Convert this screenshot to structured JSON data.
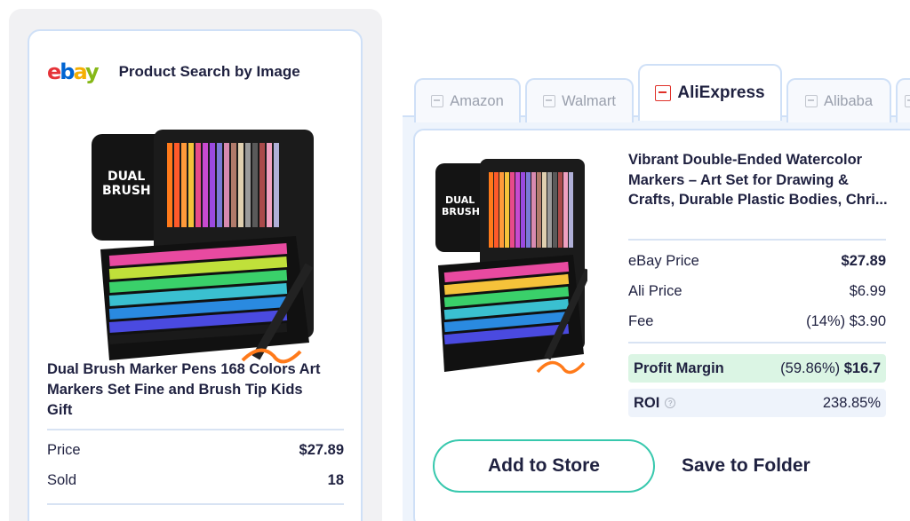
{
  "left_panel": {
    "header_title": "Product Search by Image",
    "logo": {
      "e": "e",
      "b": "b",
      "a": "a",
      "y": "y"
    },
    "product_title": "Dual Brush Marker Pens 168 Colors Art Markers Set Fine and Brush Tip Kids Gift",
    "price_label": "Price",
    "price_value": "$27.89",
    "sold_label": "Sold",
    "sold_value": "18"
  },
  "tabs": [
    {
      "label": "Amazon",
      "icon": "store-icon"
    },
    {
      "label": "Walmart",
      "icon": "store-icon"
    },
    {
      "label": "AliExpress",
      "icon": "aliexpress-bag-icon",
      "active": true
    },
    {
      "label": "Alibaba",
      "icon": "store-icon"
    }
  ],
  "right_panel": {
    "product_title": "Vibrant Double-Ended Watercolor Markers – Art Set for Drawing & Crafts, Durable Plastic Bodies, Chri...",
    "ebay_price_label": "eBay Price",
    "ebay_price_value": "$27.89",
    "ali_price_label": "Ali Price",
    "ali_price_value": "$6.99",
    "fee_label": "Fee",
    "fee_value": "(14%) $3.90",
    "profit_label": "Profit Margin",
    "profit_percent": "(59.86%)",
    "profit_value": "$16.7",
    "roi_label": "ROI",
    "roi_value": "238.85%",
    "add_button": "Add to Store",
    "save_button": "Save to Folder"
  },
  "colors": {
    "accent_teal": "#37c8ad",
    "profit_bg": "#dbf5e4",
    "card_border": "#cfe0f7",
    "ali_red": "#e0322a"
  }
}
